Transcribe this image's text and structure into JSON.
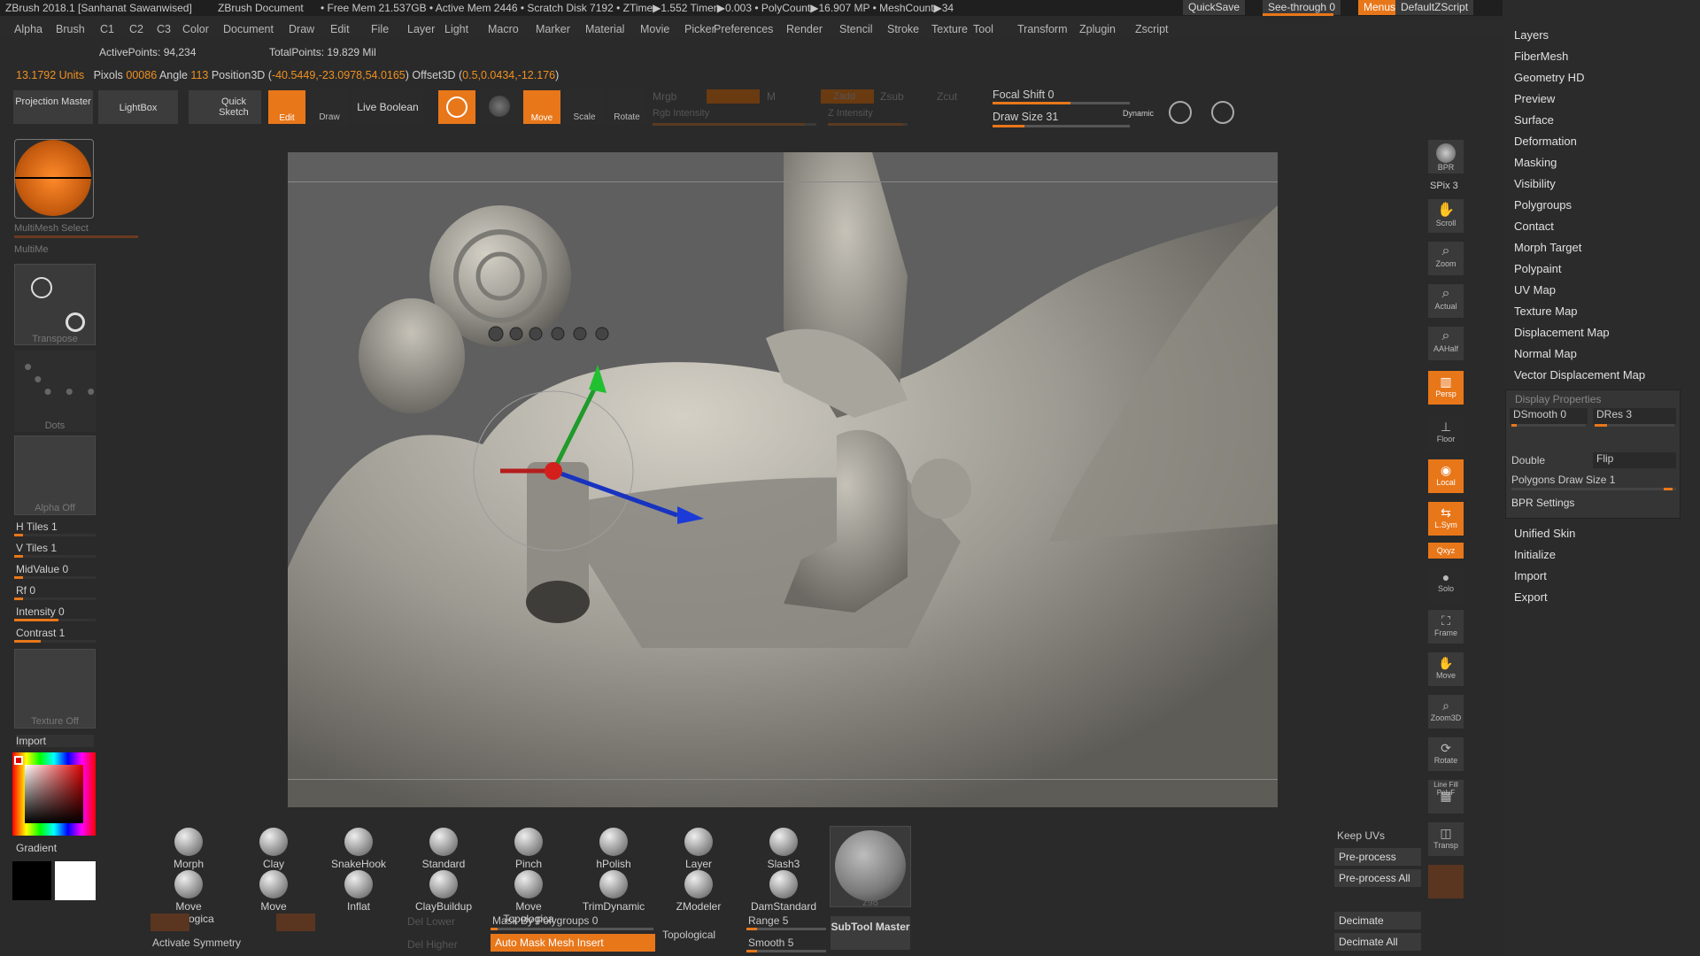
{
  "titlebar": {
    "app": "ZBrush 2018.1 [Sanhanat Sawanwised]",
    "document": "ZBrush Document",
    "stats": "• Free Mem 21.537GB • Active Mem 2446 • Scratch Disk 7192 • ZTime▶1.552 Timer▶0.003 • PolyCount▶16.907 MP • MeshCount▶34",
    "quicksave": "QuickSave",
    "see_through": "See-through 0",
    "menus": "Menus",
    "script": "DefaultZScript"
  },
  "menubar": {
    "items": [
      "Alpha",
      "Brush",
      "C1",
      "C2",
      "C3",
      "Color",
      "Document",
      "Draw",
      "Edit",
      "File",
      "Layer",
      "Light",
      "Macro",
      "Marker",
      "Material",
      "Movie",
      "Picker",
      "Preferences",
      "Render",
      "Stencil",
      "Stroke",
      "Texture",
      "Tool",
      "Transform",
      "Zplugin",
      "Zscript"
    ]
  },
  "info": {
    "active_points": "ActivePoints: 94,234",
    "total_points": "TotalPoints: 19.829 Mil",
    "units": "13.1792 Units",
    "pixols_label": "Pixols",
    "pixols_val": "00086",
    "angle_label": "Angle",
    "angle_val": "113",
    "position_label": "Position3D (",
    "position_val": "-40.5449,-23.0978,54.0165",
    "offset_label": ") Offset3D (",
    "offset_val": "0.5,0.0434,-12.176",
    "close": ")"
  },
  "toolbar": {
    "projection_master": "Projection Master",
    "lightbox": "LightBox",
    "quick_sketch": "Quick Sketch",
    "edit": "Edit",
    "draw": "Draw",
    "live_boolean": "Live Boolean",
    "move": "Move",
    "scale": "Scale",
    "rotate": "Rotate",
    "mrgb": "Mrgb",
    "m": "M",
    "zadd": "Zadd",
    "zsub": "Zsub",
    "zcut": "Zcut",
    "rgb_intensity": "Rgb Intensity",
    "z_intensity": "Z Intensity",
    "focal_shift": "Focal Shift 0",
    "draw_size": "Draw Size 31",
    "dynamic": "Dynamic"
  },
  "leftpanel": {
    "multimesh_select": "MultiMesh Select",
    "multimesh": "MultiMe",
    "transpose": "Transpose",
    "dots": "Dots",
    "alpha_off": "Alpha Off",
    "h_tiles": "H Tiles 1",
    "v_tiles": "V Tiles 1",
    "midvalue": "MidValue 0",
    "rf": "Rf 0",
    "intensity": "Intensity 0",
    "contrast": "Contrast 1",
    "texture_off": "Texture Off",
    "import": "Import",
    "gradient": "Gradient"
  },
  "righttoolbar": {
    "bpr": "BPR",
    "spix": "SPix 3",
    "scroll": "Scroll",
    "zoom": "Zoom",
    "actual": "Actual",
    "aahalf": "AAHalf",
    "persp": "Persp",
    "floor": "Floor",
    "local": "Local",
    "lsym": "L.Sym",
    "xyz": "Qxyz",
    "solo": "Solo",
    "frame": "Frame",
    "move": "Move",
    "zoom3d": "Zoom3D",
    "rotate": "Rotate",
    "linefill": "Line Fill PolyF",
    "transp": "Transp"
  },
  "rightpanel": {
    "items_top": [
      "Layers",
      "FiberMesh",
      "Geometry HD",
      "Preview",
      "Surface",
      "Deformation",
      "Masking",
      "Visibility",
      "Polygroups",
      "Contact",
      "Morph Target",
      "Polypaint",
      "UV Map",
      "Texture Map",
      "Displacement Map",
      "Normal Map",
      "Vector Displacement Map"
    ],
    "display_properties": "Display Properties",
    "dsmooth": "DSmooth 0",
    "dres": "DRes 3",
    "double": "Double",
    "flip": "Flip",
    "polygons_draw_size": "Polygons Draw Size 1",
    "bpr_settings": "BPR Settings",
    "items_bottom": [
      "Unified Skin",
      "Initialize",
      "Import",
      "Export"
    ]
  },
  "shelf": {
    "brushes_row1": [
      "Morph",
      "Clay",
      "SnakeHook",
      "Standard",
      "Pinch",
      "hPolish",
      "Layer",
      "Slash3"
    ],
    "brushes_row2": [
      "Move Topologica",
      "Move",
      "Inflat",
      "ClayBuildup",
      "Move Topologica",
      "TrimDynamic",
      "ZModeler",
      "DamStandard"
    ],
    "material": "z98",
    "activate_symmetry": "Activate Symmetry",
    "del_lower": "Del Lower",
    "del_higher": "Del Higher",
    "mask_by_polygroups": "Mask By Polygroups 0",
    "auto_mask_mesh_insert": "Auto Mask Mesh Insert",
    "topological": "Topological",
    "range": "Range 5",
    "smooth": "Smooth 5",
    "subtool_master": "SubTool Master",
    "keep_uvs": "Keep UVs",
    "preprocess_curr": "Pre-process Curr",
    "preprocess_all": "Pre-process All",
    "decimate_current": "Decimate Curren",
    "decimate_all": "Decimate All"
  }
}
